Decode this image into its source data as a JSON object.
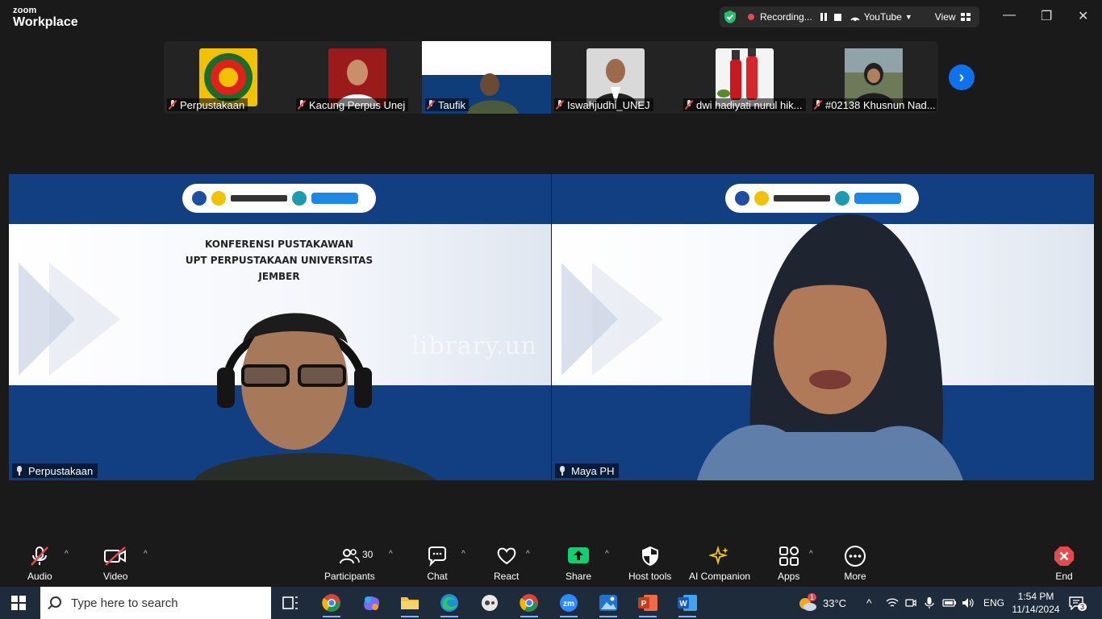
{
  "window": {
    "logo_line1": "zoom",
    "logo_line2": "Workplace",
    "recording_label": "Recording...",
    "stream_label": "YouTube",
    "view_label": "View"
  },
  "gallery": [
    {
      "name": "Perpustakaan",
      "pic_color": "#f2c200"
    },
    {
      "name": "Kacung Perpus Unej",
      "pic_color": "#9b1b1b"
    },
    {
      "name": "Taufik",
      "pic_color": "#0f3d7a"
    },
    {
      "name": "Iswahjudhi_UNEJ",
      "pic_color": "#d9d9d9"
    },
    {
      "name": "dwi hadiyati nurul hik...",
      "pic_color": "#e9e9e9"
    },
    {
      "name": "#02138 Khusnun Nad...",
      "pic_color": "#6d7a5a"
    }
  ],
  "main_tiles": [
    {
      "name": "Perpustakaan",
      "banner_line1": "KONFERENSI PUSTAKAWAN",
      "banner_line2": "UPT PERPUSTAKAAN UNIVERSITAS JEMBER"
    },
    {
      "name": "Maya PH"
    }
  ],
  "watermark": "library.un",
  "toolbar": {
    "audio": "Audio",
    "video": "Video",
    "participants": "Participants",
    "participants_count": "30",
    "chat": "Chat",
    "react": "React",
    "share": "Share",
    "host_tools": "Host tools",
    "ai_companion": "AI Companion",
    "apps": "Apps",
    "more": "More",
    "end": "End"
  },
  "taskbar": {
    "search_placeholder": "Type here to search",
    "weather_temp": "33°C",
    "weather_badge": "1",
    "language": "ENG",
    "time": "1:54 PM",
    "date": "11/14/2024",
    "notifications": "3"
  },
  "colors": {
    "active_speaker": "#23d99b",
    "zoom_blue": "#0e72ed",
    "danger": "#e5484d",
    "share_green": "#0dd270"
  }
}
